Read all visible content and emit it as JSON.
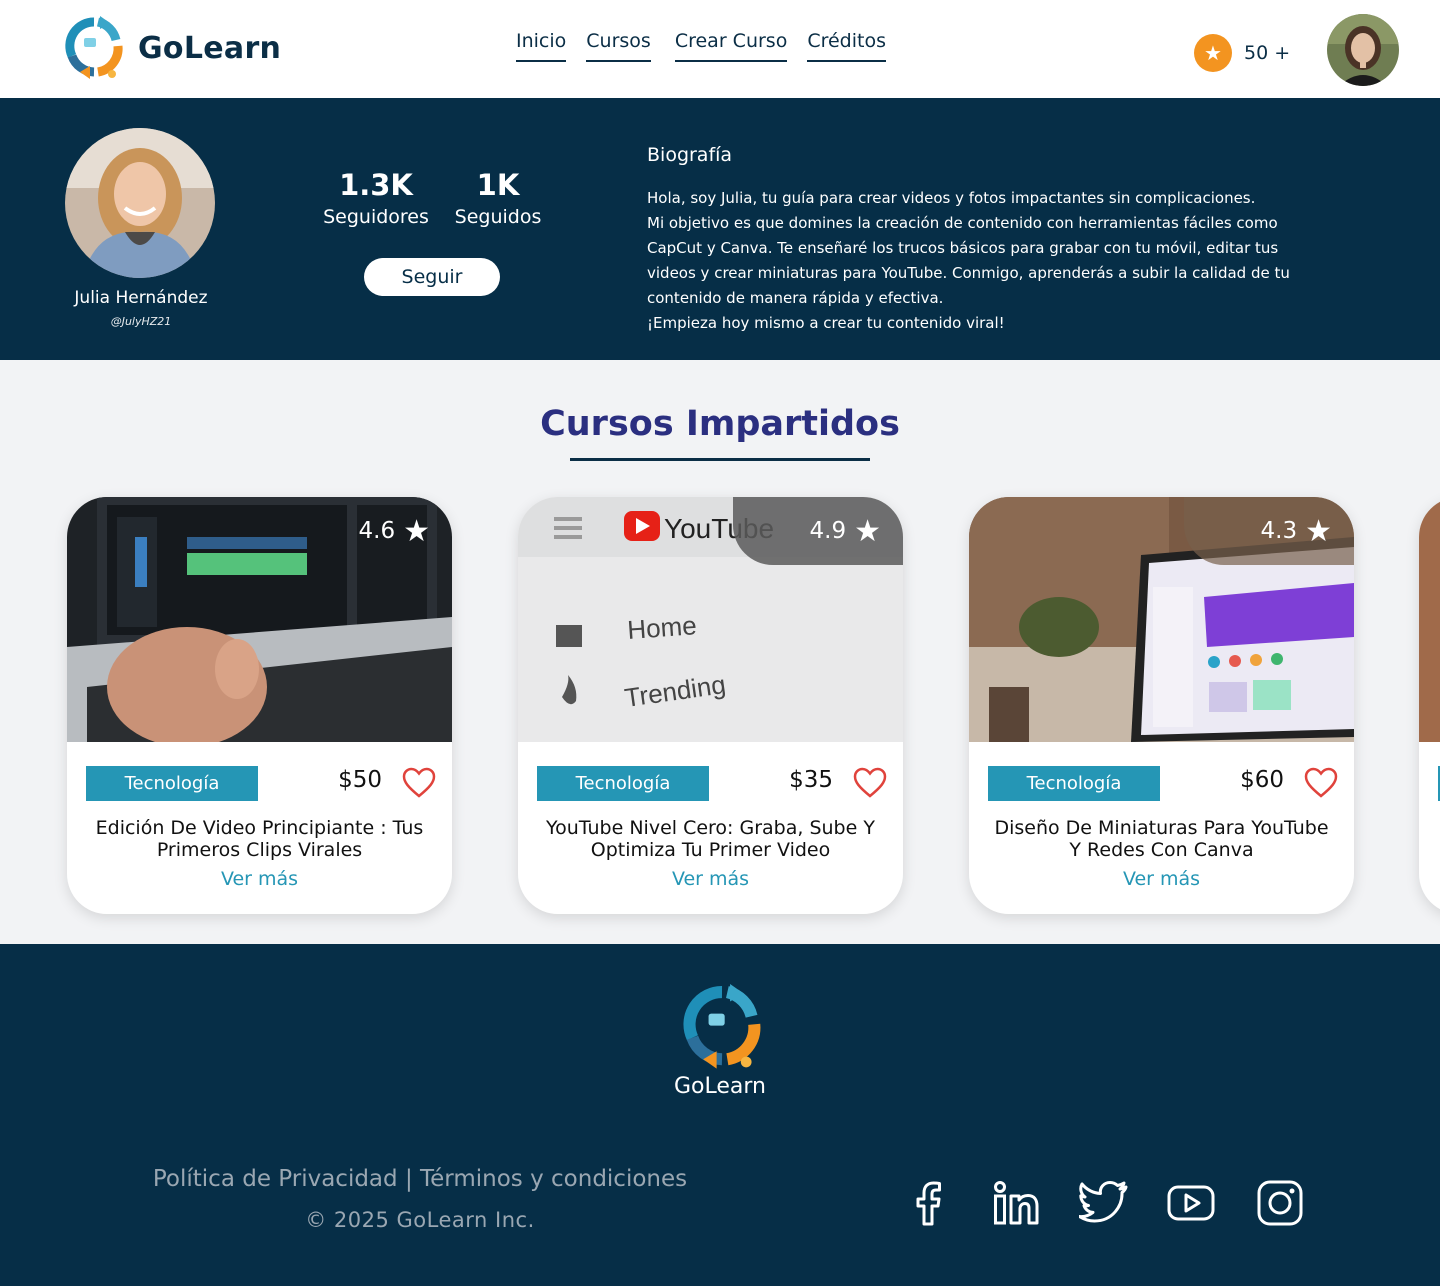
{
  "header": {
    "brand": "GoLearn",
    "nav": [
      "Inicio",
      "Cursos",
      "Crear Curso",
      "Créditos"
    ],
    "credits": "50 +"
  },
  "profile": {
    "name": "Julia Hernández",
    "handle": "@JulyHZ21",
    "followers_count": "1.3K",
    "followers_label": "Seguidores",
    "following_count": "1K",
    "following_label": "Seguidos",
    "follow_button": "Seguir",
    "bio_title": "Biografía",
    "bio_lines": [
      "Hola, soy Julia, tu guía para crear videos y fotos impactantes sin complicaciones.",
      "Mi objetivo es que domines la creación de contenido con herramientas fáciles como",
      "CapCut y Canva. Te enseñaré los trucos básicos para grabar con tu móvil, editar tus",
      "videos y crear miniaturas para YouTube. Conmigo, aprenderás a subir la calidad de tu",
      "contenido de manera rápida y efectiva.",
      "¡Empieza hoy mismo a crear tu contenido viral!"
    ]
  },
  "courses": {
    "title": "Cursos Impartidos",
    "items": [
      {
        "rating": "4.6",
        "category": "Tecnología",
        "price": "$50",
        "title_lines": [
          "Edición De Video Principiante : Tus",
          "Primeros Clips Virales"
        ],
        "more": "Ver más"
      },
      {
        "rating": "4.9",
        "category": "Tecnología",
        "price": "$35",
        "title_lines": [
          "YouTube Nivel Cero: Graba, Sube Y",
          "Optimiza Tu Primer Video"
        ],
        "more": "Ver más",
        "thumb_text": [
          "YouTube",
          "Home",
          "Trending"
        ]
      },
      {
        "rating": "4.3",
        "category": "Tecnología",
        "price": "$60",
        "title_lines": [
          "Diseño De Miniaturas Para YouTube",
          "Y Redes Con Canva"
        ],
        "more": "Ver más"
      }
    ]
  },
  "footer": {
    "brand": "GoLearn",
    "privacy": "Política de Privacidad",
    "separator": "|",
    "terms": "Términos y condiciones",
    "copyright": "© 2025 GoLearn Inc.",
    "social": [
      "facebook-icon",
      "linkedin-icon",
      "twitter-icon",
      "youtube-icon",
      "instagram-icon"
    ]
  },
  "colors": {
    "navy": "#062e47",
    "accent_teal": "#2596b5",
    "title_indigo": "#2b2f80",
    "credit_orange": "#f39420",
    "heart_red": "#e0433c"
  }
}
